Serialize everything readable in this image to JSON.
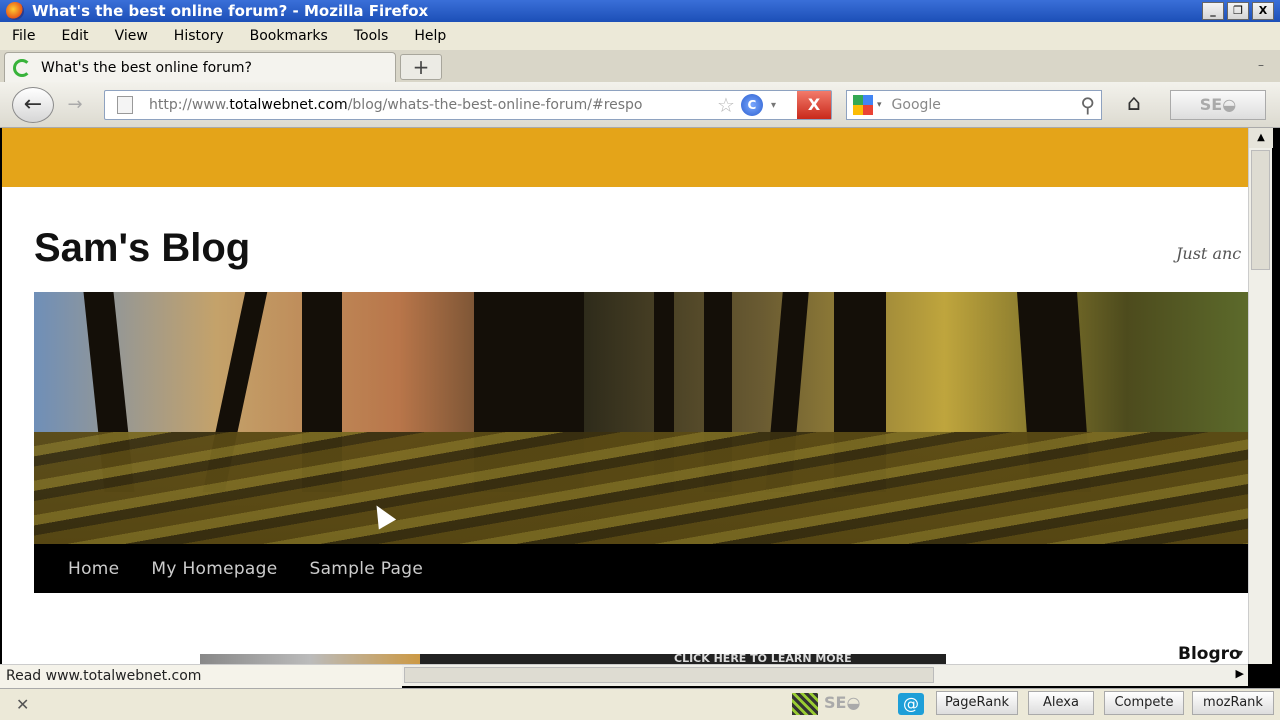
{
  "window": {
    "title": "What's the best online forum? - Mozilla Firefox",
    "controls": {
      "minimize": "_",
      "maximize": "❐",
      "close": "X"
    }
  },
  "menu": [
    "File",
    "Edit",
    "View",
    "History",
    "Bookmarks",
    "Tools",
    "Help"
  ],
  "tab": {
    "title": "What's the best online forum?",
    "new_tab": "+",
    "list_arrow": "–"
  },
  "navbar": {
    "back": "←",
    "forward": "→",
    "url_prefix": "http://www.",
    "url_domain": "totalwebnet.com",
    "url_path": "/blog/whats-the-best-online-forum/#respo",
    "star": "☆",
    "reload": "C",
    "drop": "▾",
    "stop": "X",
    "search_placeholder": "Google",
    "search_drop": "▾",
    "search_icon": "⚲",
    "home": "⌂",
    "seo": "SE◒"
  },
  "page": {
    "site_title": "Sam's Blog",
    "tagline": "Just anc",
    "nav": [
      "Home",
      "My Homepage",
      "Sample Page"
    ],
    "ad_text": "CLICK HERE TO LEARN MORE",
    "blogroll": "Blogro",
    "blogroll_drop": "▾"
  },
  "scroll": {
    "up": "▲",
    "right": "▶"
  },
  "status": {
    "link": "Read www.totalwebnet.com",
    "close": "✕",
    "seo": "SE◒",
    "at": "@",
    "tags": [
      "PageRank",
      "Alexa",
      "Compete",
      "mozRank"
    ]
  }
}
